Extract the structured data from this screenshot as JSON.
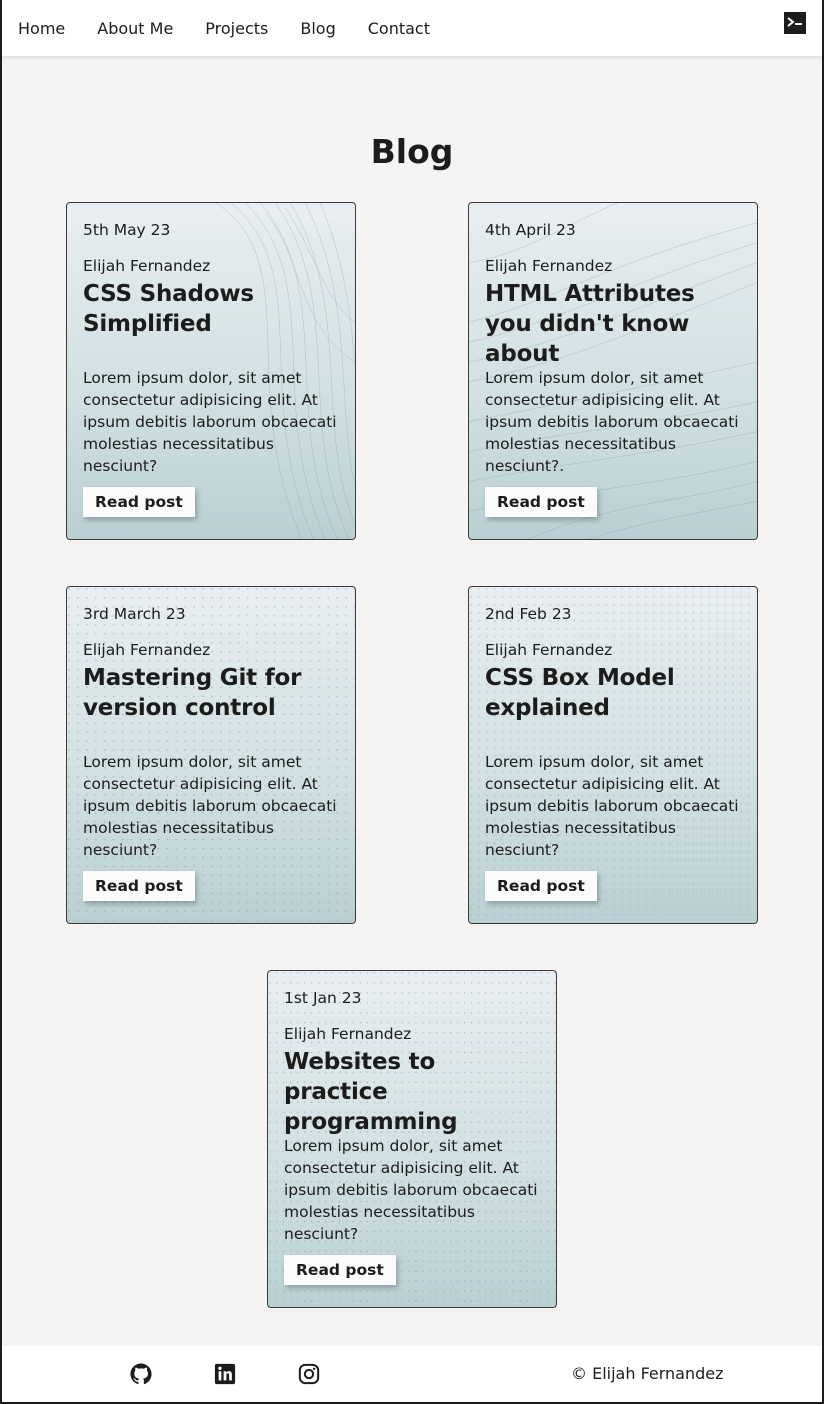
{
  "nav": {
    "items": [
      "Home",
      "About Me",
      "Projects",
      "Blog",
      "Contact"
    ],
    "terminal_icon": "terminal-icon"
  },
  "page": {
    "title": "Blog"
  },
  "posts": [
    {
      "date": "5th May 23",
      "author": "Elijah Fernandez",
      "title": "CSS Shadows Simplified",
      "excerpt": "Lorem ipsum dolor, sit amet consectetur adipisicing elit. At ipsum debitis laborum obcaecati molestias necessitatibus nesciunt?",
      "button": "Read post",
      "pattern": "lines"
    },
    {
      "date": "4th April 23",
      "author": "Elijah Fernandez",
      "title": "HTML Attributes you didn't know about",
      "excerpt": "Lorem ipsum dolor, sit amet consectetur adipisicing elit. At ipsum debitis laborum obcaecati molestias necessitatibus nesciunt?.",
      "button": "Read post",
      "pattern": "lines"
    },
    {
      "date": "3rd March 23",
      "author": "Elijah Fernandez",
      "title": "Mastering Git for version control",
      "excerpt": "Lorem ipsum dolor, sit amet consectetur adipisicing elit. At ipsum debitis laborum obcaecati molestias necessitatibus nesciunt?",
      "button": "Read post",
      "pattern": "dots"
    },
    {
      "date": "2nd Feb 23",
      "author": "Elijah Fernandez",
      "title": "CSS Box Model explained",
      "excerpt": "Lorem ipsum dolor, sit amet consectetur adipisicing elit. At ipsum debitis laborum obcaecati molestias necessitatibus nesciunt?",
      "button": "Read post",
      "pattern": "dots"
    },
    {
      "date": "1st Jan 23",
      "author": "Elijah Fernandez",
      "title": "Websites to practice programming",
      "excerpt": "Lorem ipsum dolor, sit amet consectetur adipisicing elit. At ipsum debitis laborum obcaecati molestias necessitatibus nesciunt?",
      "button": "Read post",
      "pattern": "dots"
    }
  ],
  "footer": {
    "social_icons": [
      "github-icon",
      "linkedin-icon",
      "instagram-icon"
    ],
    "copyright": "© Elijah Fernandez"
  }
}
